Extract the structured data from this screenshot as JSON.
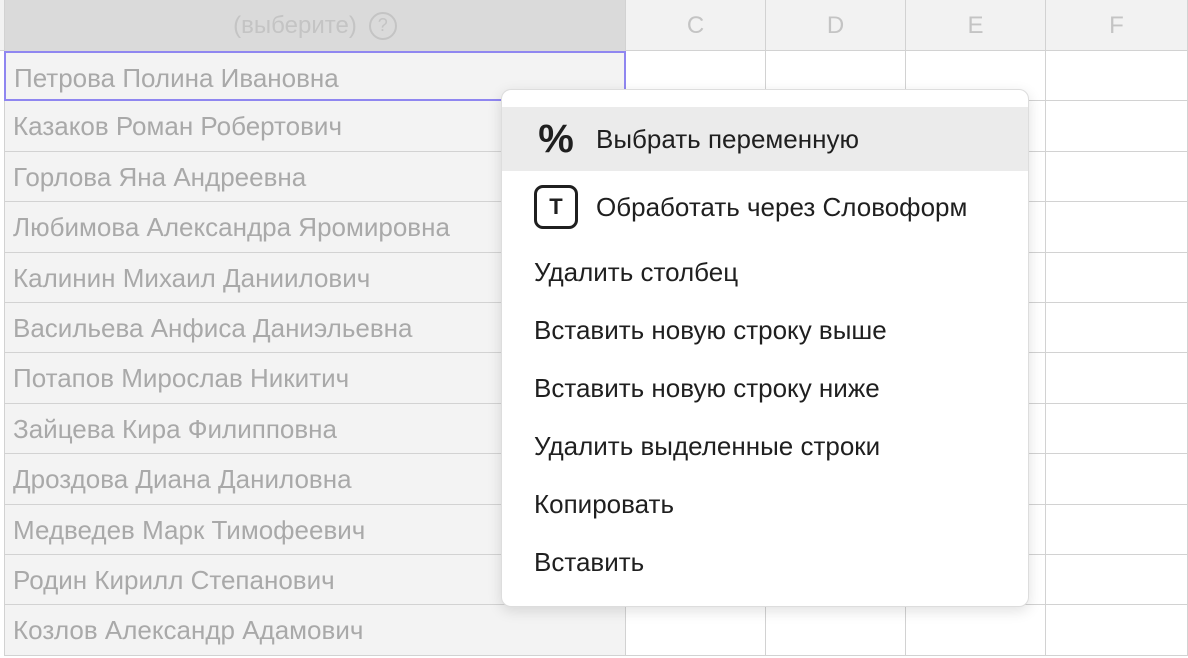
{
  "header": {
    "column_b": {
      "placeholder": "(выберите)",
      "help_symbol": "?"
    },
    "columns": [
      "C",
      "D",
      "E",
      "F"
    ]
  },
  "rows": [
    "Петрова Полина Ивановна",
    "Казаков Роман Робертович",
    "Горлова Яна Андреевна",
    "Любимова Александра Яромировна",
    "Калинин Михаил Даниилович",
    "Васильева Анфиса Даниэльевна",
    "Потапов Мирослав Никитич",
    "Зайцева Кира Филипповна",
    "Дроздова Диана Даниловна",
    "Медведев Марк Тимофеевич",
    "Родин Кирилл Степанович",
    "Козлов Александр Адамович"
  ],
  "context_menu": {
    "items": [
      {
        "label": "Выбрать переменную",
        "icon": "percent-icon",
        "glyph": "%"
      },
      {
        "label": "Обработать через Словоформ",
        "icon": "t-box-icon",
        "glyph": "T"
      },
      {
        "label": "Удалить столбец"
      },
      {
        "label": "Вставить новую строку выше"
      },
      {
        "label": "Вставить новую строку ниже"
      },
      {
        "label": "Удалить выделенные строки"
      },
      {
        "label": "Копировать"
      },
      {
        "label": "Вставить"
      }
    ]
  },
  "colors": {
    "selection_border": "#8f86f0",
    "menu_highlight": "#ebebeb"
  }
}
